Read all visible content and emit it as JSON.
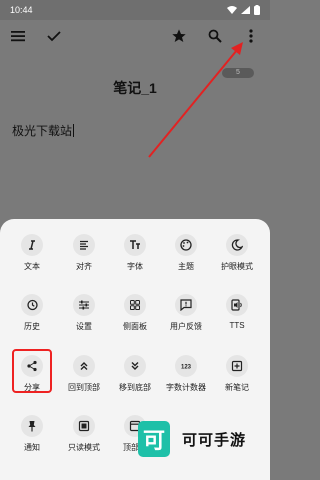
{
  "status_bar": {
    "time": "10:44",
    "icons": [
      "wifi-icon",
      "signal-icon",
      "battery-icon"
    ]
  },
  "toolbar": {
    "icons": [
      "menu-icon",
      "check-icon",
      "star-icon",
      "search-icon",
      "more-vert-icon"
    ]
  },
  "note": {
    "title": "笔记_1",
    "badge": "5",
    "body": "极光下载站"
  },
  "menu": {
    "items": [
      {
        "label": "文本",
        "icon": "text-italic-icon"
      },
      {
        "label": "对齐",
        "icon": "align-icon"
      },
      {
        "label": "字体",
        "icon": "font-icon"
      },
      {
        "label": "主题",
        "icon": "palette-icon"
      },
      {
        "label": "护眼模式",
        "icon": "moon-icon"
      },
      {
        "label": "历史",
        "icon": "history-icon"
      },
      {
        "label": "设置",
        "icon": "sliders-icon"
      },
      {
        "label": "侧面板",
        "icon": "grid-icon"
      },
      {
        "label": "用户反馈",
        "icon": "feedback-icon"
      },
      {
        "label": "TTS",
        "icon": "speaker-icon"
      },
      {
        "label": "分享",
        "icon": "share-icon"
      },
      {
        "label": "回到顶部",
        "icon": "double-chevron-up-icon"
      },
      {
        "label": "移到底部",
        "icon": "double-chevron-down-icon"
      },
      {
        "label": "字数计数器",
        "icon": "counter-123-icon"
      },
      {
        "label": "新笔记",
        "icon": "new-note-icon"
      },
      {
        "label": "通知",
        "icon": "pin-icon"
      },
      {
        "label": "只读模式",
        "icon": "read-only-icon"
      },
      {
        "label": "顶部栏",
        "icon": "topbar-icon"
      }
    ]
  },
  "watermark": {
    "logo_char": "可",
    "text": "可可手游"
  },
  "colors": {
    "accent_red": "#e22222",
    "watermark_green": "#1ec0a8"
  }
}
